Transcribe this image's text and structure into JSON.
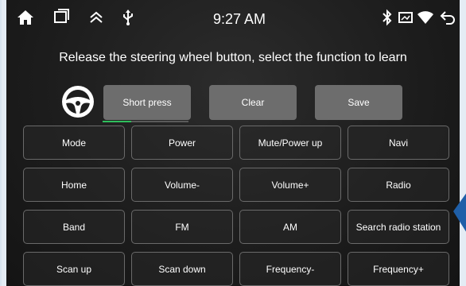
{
  "status_bar": {
    "time": "9:27 AM",
    "icons": [
      "home-icon",
      "recent-apps-icon",
      "collapse-up-icon",
      "usb-icon",
      "bluetooth-icon",
      "cast-icon",
      "wifi-icon",
      "back-icon"
    ]
  },
  "instruction": "Release the steering wheel button, select the function to learn",
  "actions": {
    "short_press": "Short press",
    "clear": "Clear",
    "save": "Save"
  },
  "functions": [
    [
      "Mode",
      "Power",
      "Mute/Power up",
      "Navi"
    ],
    [
      "Home",
      "Volume-",
      "Volume+",
      "Radio"
    ],
    [
      "Band",
      "FM",
      "AM",
      "Search radio station"
    ],
    [
      "Scan up",
      "Scan down",
      "Frequency-",
      "Frequency+"
    ]
  ],
  "colors": {
    "accent_green": "#2fbf5c",
    "button_gray": "#6d6d6d",
    "arrow_blue": "#1f5fa8"
  }
}
